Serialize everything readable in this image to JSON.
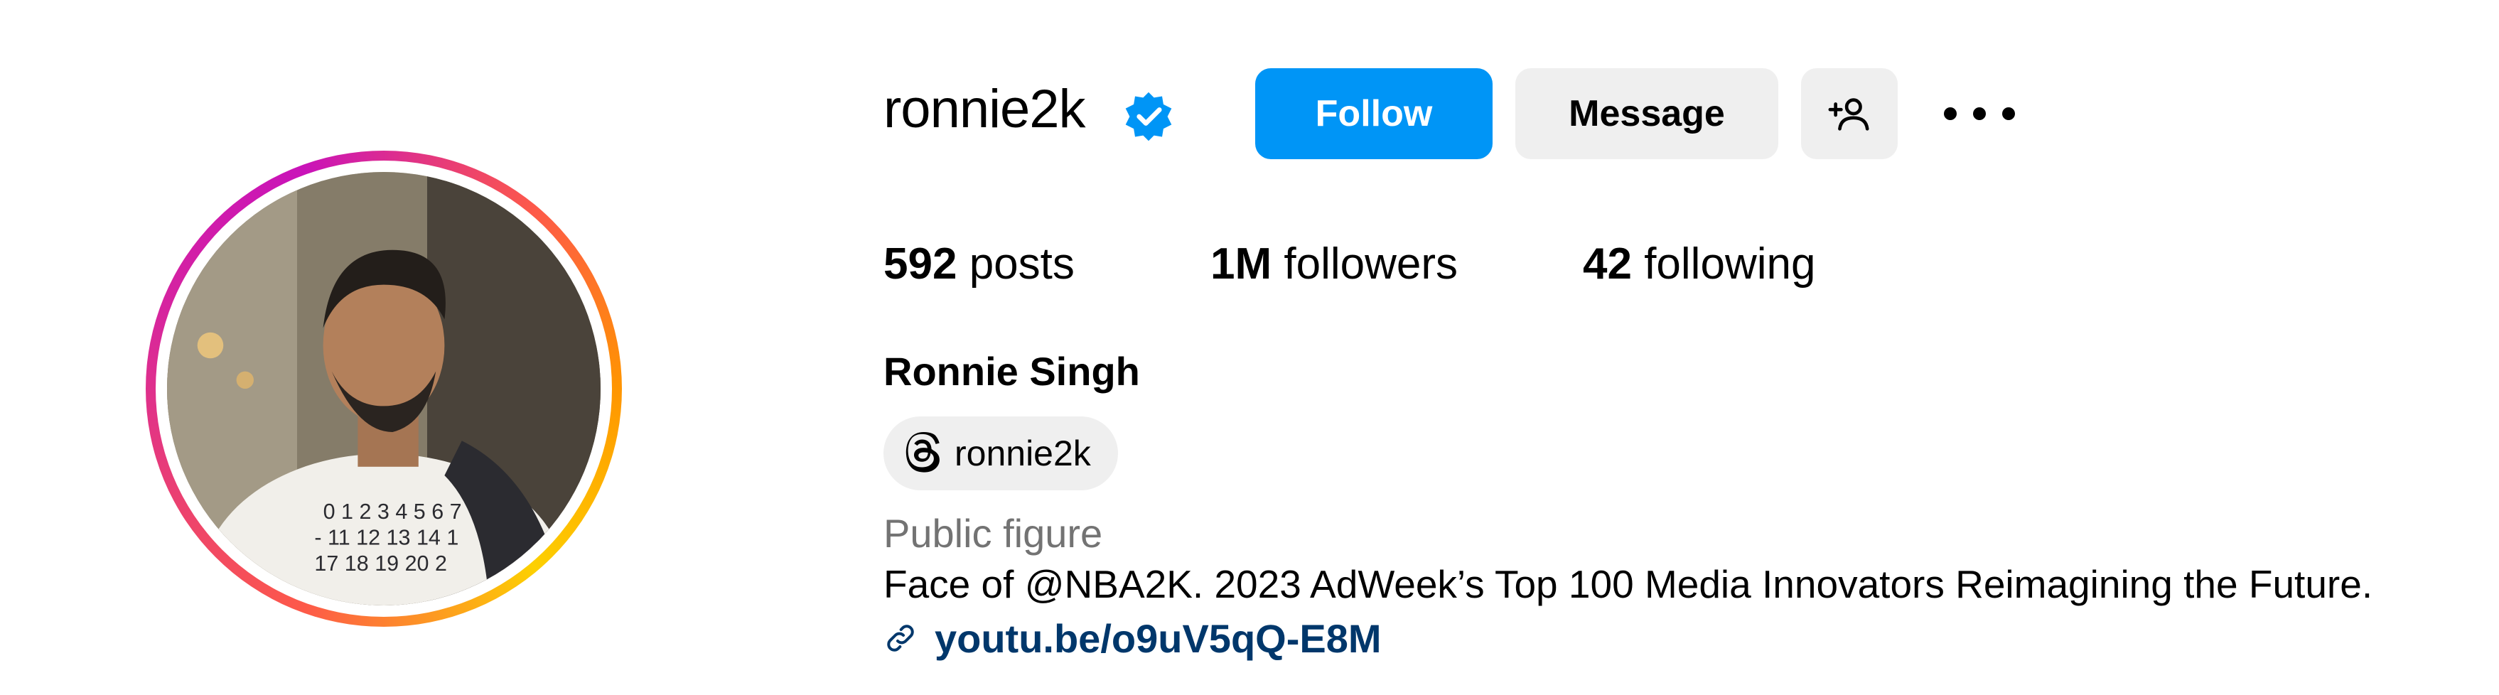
{
  "profile": {
    "username": "ronnie2k",
    "verified": true,
    "full_name": "Ronnie Singh",
    "threads_handle": "ronnie2k",
    "category": "Public figure",
    "bio": "Face of @NBA2K. 2023 AdWeek’s Top 100 Media Innovators Reimagining the Future.",
    "link": "youtu.be/o9uV5qQ-E8M"
  },
  "actions": {
    "follow_label": "Follow",
    "message_label": "Message",
    "add_user_icon": "person-plus-icon",
    "more_icon": "more-horizontal-icon"
  },
  "stats": {
    "posts_count": "592",
    "posts_label": "posts",
    "followers_count": "1M",
    "followers_label": "followers",
    "following_count": "42",
    "following_label": "following"
  },
  "colors": {
    "primary": "#0095f6",
    "secondary_button": "#efefef",
    "link": "#00376b",
    "muted": "#737373"
  }
}
